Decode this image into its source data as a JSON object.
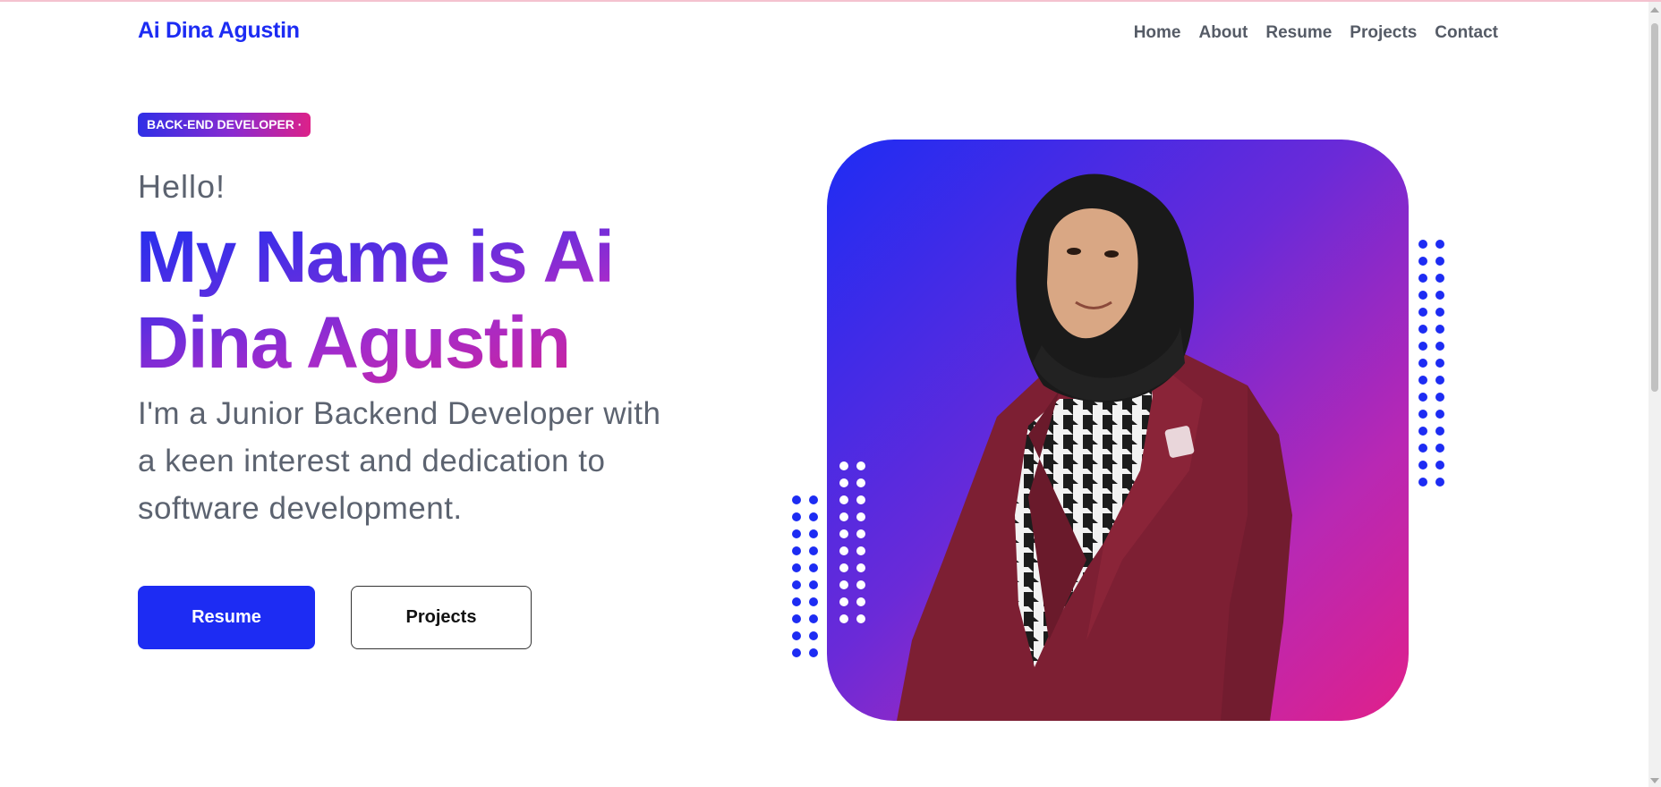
{
  "brand": "Ai Dina Agustin",
  "nav": {
    "items": [
      "Home",
      "About",
      "Resume",
      "Projects",
      "Contact"
    ]
  },
  "hero": {
    "badge": "BACK-END DEVELOPER ·",
    "greeting": "Hello!",
    "headline_line1": "My Name is Ai",
    "headline_line2": "Dina Agustin",
    "intro": "I'm a Junior Backend Developer with a keen interest and dedication to software development.",
    "primary_button": "Resume",
    "secondary_button": "Projects"
  },
  "colors": {
    "brand_blue": "#1d2cf3",
    "gradient_start": "#1e2cf4",
    "gradient_end": "#e0208a",
    "text_gray": "#5c6370"
  },
  "icons": {
    "portrait": "person-photo",
    "decor": "dot-grid"
  }
}
